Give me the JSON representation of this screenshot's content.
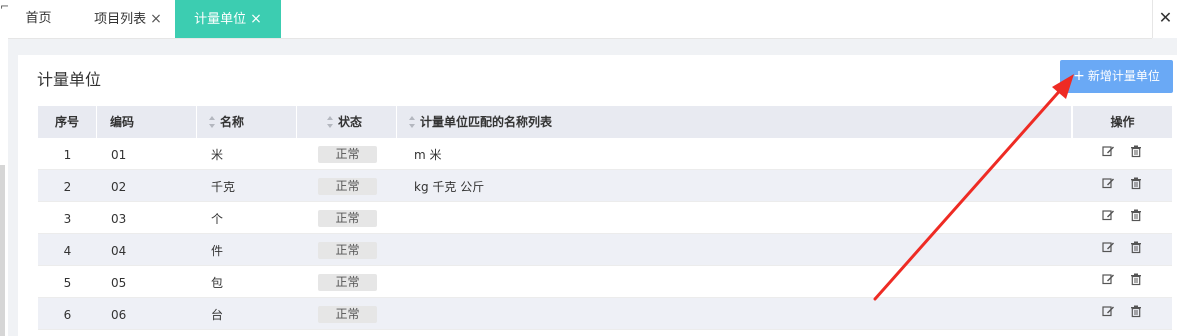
{
  "gutter": {
    "glyph": "⌐"
  },
  "tabs": [
    {
      "label": "首页",
      "closable": false,
      "active": false
    },
    {
      "label": "项目列表",
      "closable": true,
      "active": false
    },
    {
      "label": "计量单位",
      "closable": true,
      "active": true
    }
  ],
  "tab_close_glyph": "×",
  "window_close_glyph": "✕",
  "colors": {
    "active_tab": "#3ccdb1",
    "primary_button": "#6aa9f5",
    "arrow": "#ee2b24"
  },
  "panel": {
    "title": "计量单位",
    "add_button": {
      "icon": "+",
      "label": "新增计量单位"
    }
  },
  "table": {
    "headers": {
      "seq": "序号",
      "code": "编码",
      "name": "名称",
      "state": "状态",
      "match_list": "计量单位匹配的名称列表",
      "ops": "操作"
    },
    "rows": [
      {
        "seq": "1",
        "code": "01",
        "name": "米",
        "state": "正常",
        "match_list": "m 米"
      },
      {
        "seq": "2",
        "code": "02",
        "name": "千克",
        "state": "正常",
        "match_list": "kg 千克 公斤"
      },
      {
        "seq": "3",
        "code": "03",
        "name": "个",
        "state": "正常",
        "match_list": ""
      },
      {
        "seq": "4",
        "code": "04",
        "name": "件",
        "state": "正常",
        "match_list": ""
      },
      {
        "seq": "5",
        "code": "05",
        "name": "包",
        "state": "正常",
        "match_list": ""
      },
      {
        "seq": "6",
        "code": "06",
        "name": "台",
        "state": "正常",
        "match_list": ""
      }
    ]
  }
}
